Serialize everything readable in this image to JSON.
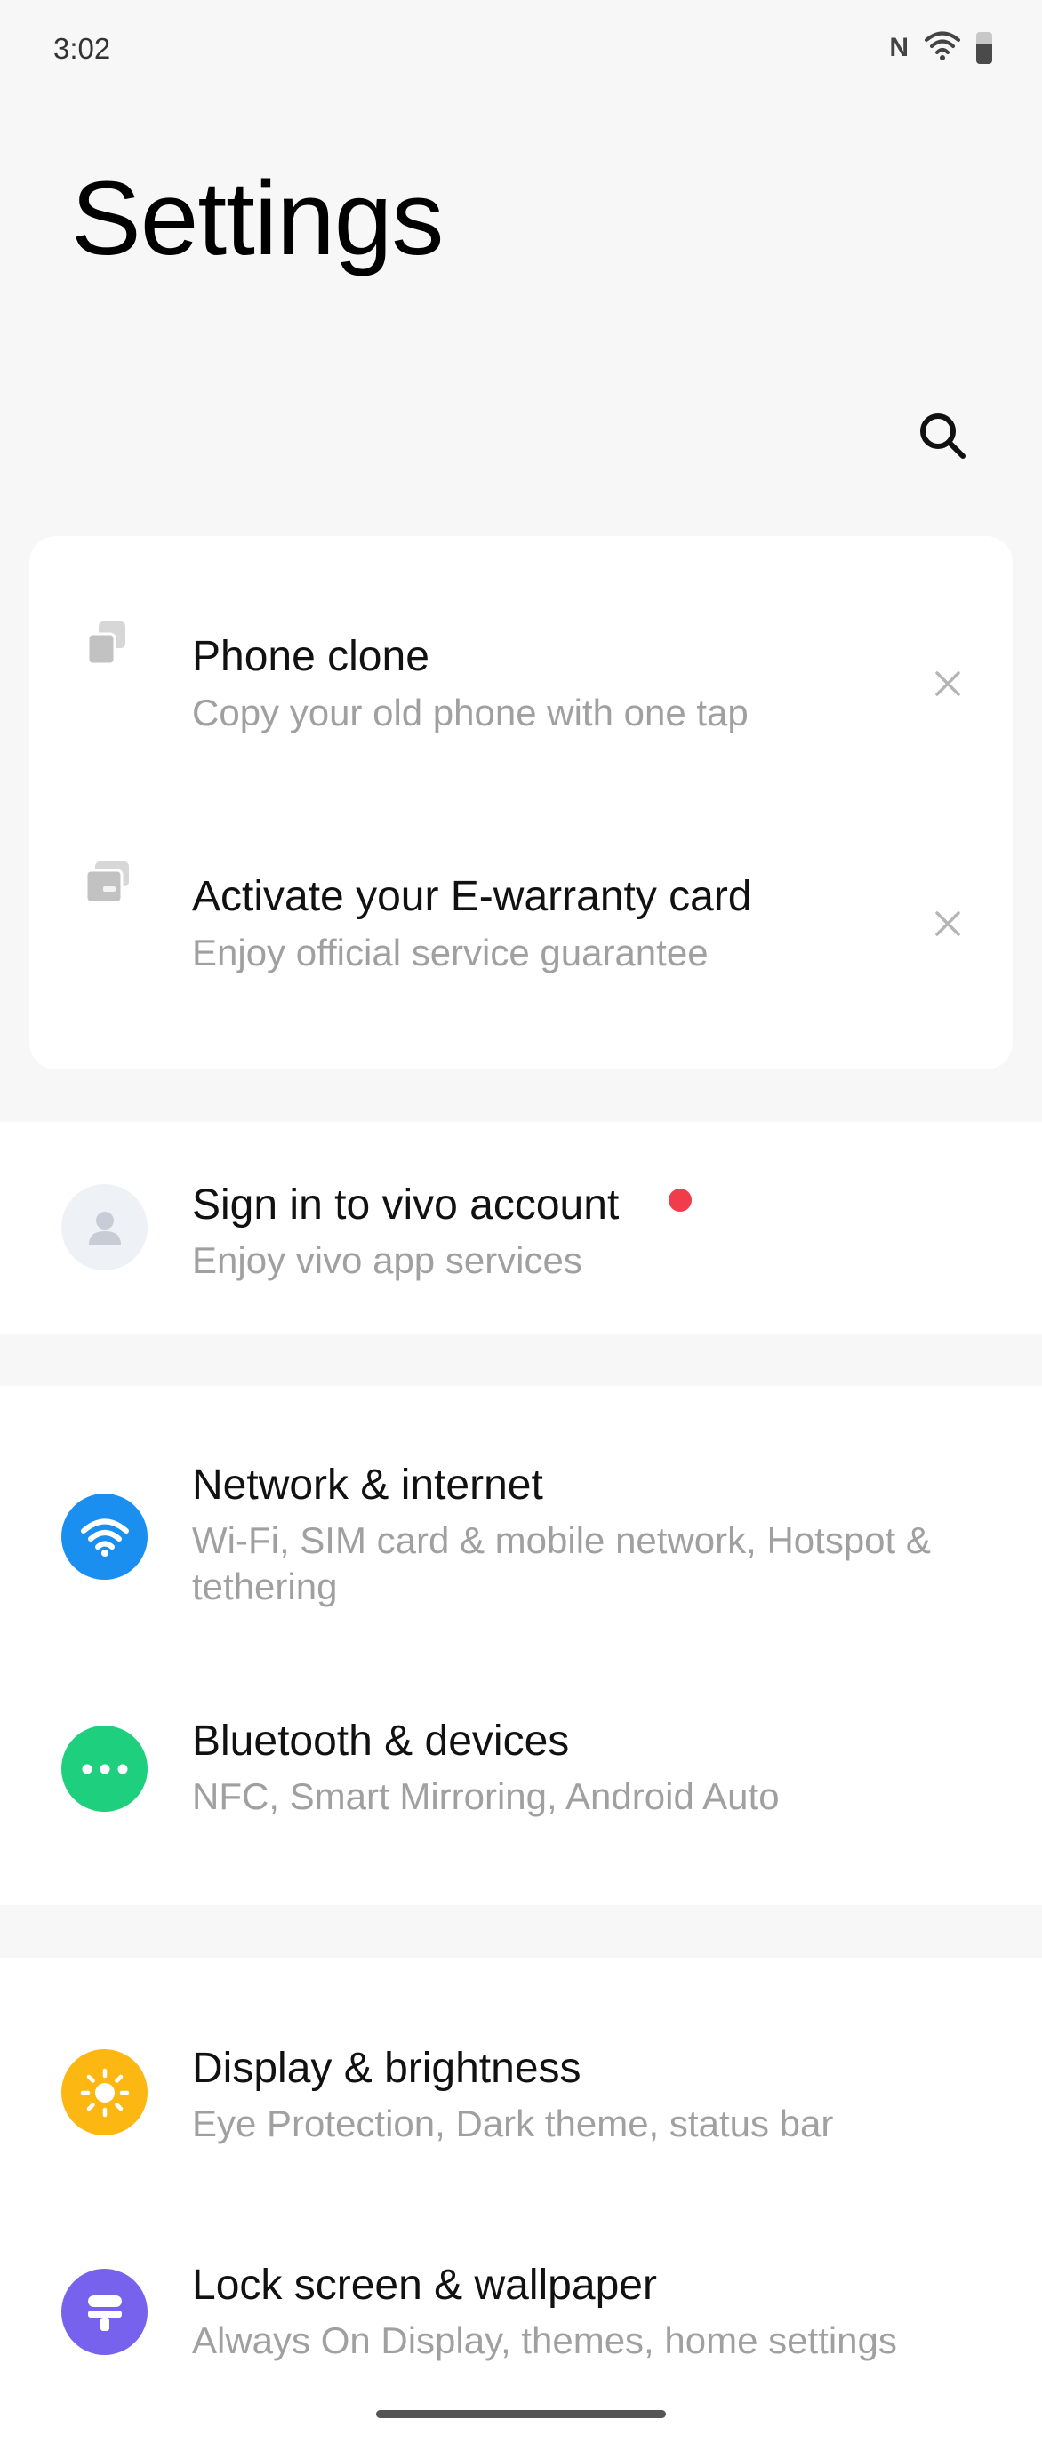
{
  "status_bar": {
    "time": "3:02",
    "icons": [
      "nfc-icon",
      "wifi-icon",
      "battery-icon"
    ],
    "nfc_glyph": "N"
  },
  "page_title": "Settings",
  "search": {
    "icon": "search-icon"
  },
  "suggestions": [
    {
      "title": "Phone clone",
      "subtitle": "Copy your old phone with one tap",
      "icon": "phone-clone-icon"
    },
    {
      "title": "Activate your E-warranty card",
      "subtitle": "Enjoy official service guarantee",
      "icon": "warranty-card-icon"
    }
  ],
  "account": {
    "title": "Sign in to vivo account",
    "subtitle": "Enjoy vivo app services",
    "icon": "avatar-icon",
    "has_notification": true
  },
  "settings_items": [
    {
      "title": "Network & internet",
      "subtitle": "Wi-Fi, SIM card & mobile network, Hotspot & tethering",
      "icon": "wifi-icon",
      "color": "#1a8ff0"
    },
    {
      "title": "Bluetooth & devices",
      "subtitle": "NFC, Smart Mirroring, Android Auto",
      "icon": "more-dots-icon",
      "color": "#1ed07e"
    },
    {
      "title": "Display & brightness",
      "subtitle": "Eye Protection, Dark theme, status bar",
      "icon": "sun-icon",
      "color": "#fcb713"
    },
    {
      "title": "Lock screen & wallpaper",
      "subtitle": "Always On Display, themes, home settings",
      "icon": "wallpaper-icon",
      "color": "#7762ee"
    }
  ],
  "colors": {
    "background": "#f7f7f7",
    "card": "#ffffff",
    "subtitle": "#a0a0a0",
    "notification_dot": "#f03c4b"
  }
}
